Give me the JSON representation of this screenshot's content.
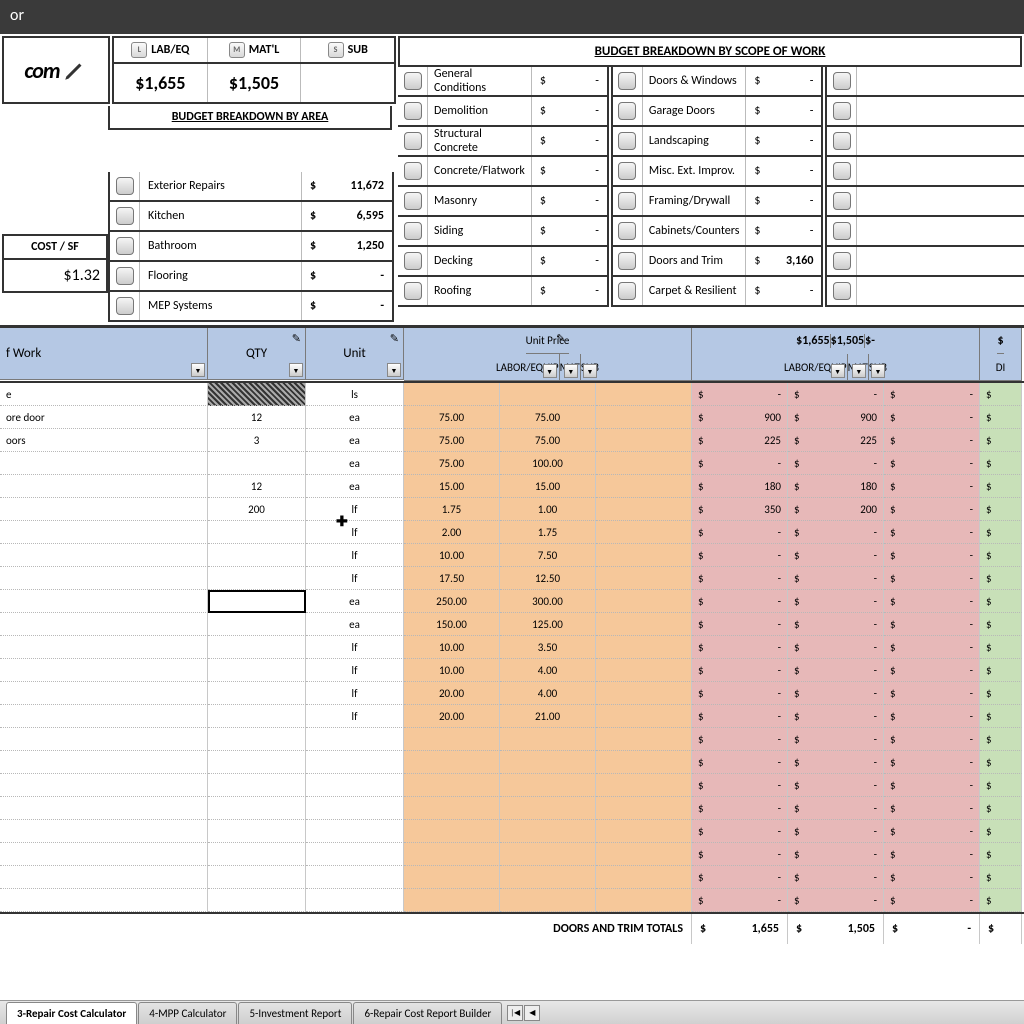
{
  "title": "or",
  "logo_text": "com",
  "legend": {
    "lab": "LAB/EQ",
    "mat": "MAT'L",
    "sub": "SUB"
  },
  "amounts": {
    "lab": "$1,655",
    "mat": "$1,505"
  },
  "bba_heading": "BUDGET BREAKDOWN BY AREA",
  "cost_sf": {
    "label": "COST / SF",
    "value": "$1.32"
  },
  "area_items": [
    {
      "label": "Exterior Repairs",
      "dollar": "$",
      "value": "11,672"
    },
    {
      "label": "Kitchen",
      "dollar": "$",
      "value": "6,595"
    },
    {
      "label": "Bathroom",
      "dollar": "$",
      "value": "1,250"
    },
    {
      "label": "Flooring",
      "dollar": "$",
      "value": "-"
    },
    {
      "label": "MEP Systems",
      "dollar": "$",
      "value": "-"
    }
  ],
  "scope_heading": "BUDGET BREAKDOWN BY SCOPE OF WORK",
  "scope_col1": [
    {
      "label": "General Conditions",
      "value": "-"
    },
    {
      "label": "Demolition",
      "value": "-"
    },
    {
      "label": "Structural Concrete",
      "value": "-"
    },
    {
      "label": "Concrete/Flatwork",
      "value": "-"
    },
    {
      "label": "Masonry",
      "value": "-"
    },
    {
      "label": "Siding",
      "value": "-"
    },
    {
      "label": "Decking",
      "value": "-"
    },
    {
      "label": "Roofing",
      "value": "-"
    }
  ],
  "scope_col2": [
    {
      "label": "Doors & Windows",
      "value": "-"
    },
    {
      "label": "Garage Doors",
      "value": "-"
    },
    {
      "label": "Landscaping",
      "value": "-"
    },
    {
      "label": "Misc. Ext. Improv.",
      "value": "-"
    },
    {
      "label": "Framing/Drywall",
      "value": "-"
    },
    {
      "label": "Cabinets/Counters",
      "value": "-"
    },
    {
      "label": "Doors and Trim",
      "value": "3,160"
    },
    {
      "label": "Carpet & Resilient",
      "value": "-"
    }
  ],
  "headers": {
    "work": "f Work",
    "qty": "QTY",
    "unit": "Unit",
    "unit_price": "Unit Price",
    "labor": "LABOR/EQUIP",
    "mat": "MAT",
    "sub": "SUB",
    "diy": "DI",
    "tot_lab": "1,655",
    "tot_mat": "1,505",
    "tot_sub": "-"
  },
  "rows": [
    {
      "desc": "e",
      "qty": "",
      "unit": "ls",
      "lab": "",
      "mat": "",
      "tlab": "-",
      "tmat": "-",
      "tsub": "-"
    },
    {
      "desc": "ore door",
      "qty": "12",
      "unit": "ea",
      "lab": "75.00",
      "mat": "75.00",
      "tlab": "900",
      "tmat": "900",
      "tsub": "-"
    },
    {
      "desc": "oors",
      "qty": "3",
      "unit": "ea",
      "lab": "75.00",
      "mat": "75.00",
      "tlab": "225",
      "tmat": "225",
      "tsub": "-"
    },
    {
      "desc": "",
      "qty": "",
      "unit": "ea",
      "lab": "75.00",
      "mat": "100.00",
      "tlab": "-",
      "tmat": "-",
      "tsub": "-"
    },
    {
      "desc": "",
      "qty": "12",
      "unit": "ea",
      "lab": "15.00",
      "mat": "15.00",
      "tlab": "180",
      "tmat": "180",
      "tsub": "-"
    },
    {
      "desc": "",
      "qty": "200",
      "unit": "lf",
      "lab": "1.75",
      "mat": "1.00",
      "tlab": "350",
      "tmat": "200",
      "tsub": "-"
    },
    {
      "desc": "",
      "qty": "",
      "unit": "lf",
      "lab": "2.00",
      "mat": "1.75",
      "tlab": "-",
      "tmat": "-",
      "tsub": "-"
    },
    {
      "desc": "",
      "qty": "",
      "unit": "lf",
      "lab": "10.00",
      "mat": "7.50",
      "tlab": "-",
      "tmat": "-",
      "tsub": "-"
    },
    {
      "desc": "",
      "qty": "",
      "unit": "lf",
      "lab": "17.50",
      "mat": "12.50",
      "tlab": "-",
      "tmat": "-",
      "tsub": "-"
    },
    {
      "desc": "",
      "qty": "",
      "unit": "ea",
      "lab": "250.00",
      "mat": "300.00",
      "tlab": "-",
      "tmat": "-",
      "tsub": "-"
    },
    {
      "desc": "",
      "qty": "",
      "unit": "ea",
      "lab": "150.00",
      "mat": "125.00",
      "tlab": "-",
      "tmat": "-",
      "tsub": "-"
    },
    {
      "desc": "",
      "qty": "",
      "unit": "lf",
      "lab": "10.00",
      "mat": "3.50",
      "tlab": "-",
      "tmat": "-",
      "tsub": "-"
    },
    {
      "desc": "",
      "qty": "",
      "unit": "lf",
      "lab": "10.00",
      "mat": "4.00",
      "tlab": "-",
      "tmat": "-",
      "tsub": "-"
    },
    {
      "desc": "",
      "qty": "",
      "unit": "lf",
      "lab": "20.00",
      "mat": "4.00",
      "tlab": "-",
      "tmat": "-",
      "tsub": "-"
    },
    {
      "desc": "",
      "qty": "",
      "unit": "lf",
      "lab": "20.00",
      "mat": "21.00",
      "tlab": "-",
      "tmat": "-",
      "tsub": "-"
    },
    {
      "desc": "",
      "qty": "",
      "unit": "",
      "lab": "",
      "mat": "",
      "tlab": "-",
      "tmat": "-",
      "tsub": "-"
    },
    {
      "desc": "",
      "qty": "",
      "unit": "",
      "lab": "",
      "mat": "",
      "tlab": "-",
      "tmat": "-",
      "tsub": "-"
    },
    {
      "desc": "",
      "qty": "",
      "unit": "",
      "lab": "",
      "mat": "",
      "tlab": "-",
      "tmat": "-",
      "tsub": "-"
    },
    {
      "desc": "",
      "qty": "",
      "unit": "",
      "lab": "",
      "mat": "",
      "tlab": "-",
      "tmat": "-",
      "tsub": "-"
    },
    {
      "desc": "",
      "qty": "",
      "unit": "",
      "lab": "",
      "mat": "",
      "tlab": "-",
      "tmat": "-",
      "tsub": "-"
    },
    {
      "desc": "",
      "qty": "",
      "unit": "",
      "lab": "",
      "mat": "",
      "tlab": "-",
      "tmat": "-",
      "tsub": "-"
    },
    {
      "desc": "",
      "qty": "",
      "unit": "",
      "lab": "",
      "mat": "",
      "tlab": "-",
      "tmat": "-",
      "tsub": "-"
    },
    {
      "desc": "",
      "qty": "",
      "unit": "",
      "lab": "",
      "mat": "",
      "tlab": "-",
      "tmat": "-",
      "tsub": "-"
    }
  ],
  "totals": {
    "label": "DOORS AND TRIM TOTALS",
    "lab": "1,655",
    "mat": "1,505",
    "sub": "-"
  },
  "tabs": [
    {
      "label": "3-Repair Cost Calculator",
      "active": true
    },
    {
      "label": "4-MPP Calculator",
      "active": false
    },
    {
      "label": "5-Investment Report",
      "active": false
    },
    {
      "label": "6-Repair Cost Report Builder",
      "active": false
    }
  ]
}
